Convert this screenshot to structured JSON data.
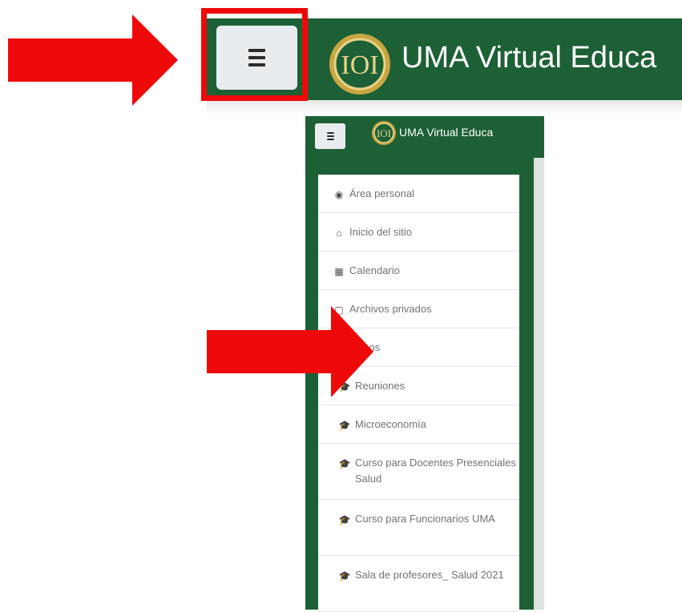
{
  "brand": {
    "name": "UMA Virtual Educa",
    "logo_text": "IOI",
    "header_color": "#1d6036",
    "annotation_color": "#ee0a0a"
  },
  "toggle_icon": "hamburger-icon",
  "nav": {
    "items": [
      {
        "label": "Área personal",
        "icon": "dashboard-icon",
        "glyph": "◉"
      },
      {
        "label": "Inicio del sitio",
        "icon": "home-icon",
        "glyph": "⌂"
      },
      {
        "label": "Calendario",
        "icon": "calendar-icon",
        "glyph": "▦"
      },
      {
        "label": "Archivos privados",
        "icon": "file-icon",
        "glyph": "▢"
      },
      {
        "label": "cursos",
        "icon": "graduation-cap-icon",
        "glyph": "🎓"
      }
    ],
    "courses": [
      {
        "label": "Reuniones",
        "icon": "graduation-cap-icon",
        "glyph": "🎓"
      },
      {
        "label": "Microeconomía",
        "icon": "graduation-cap-icon",
        "glyph": "🎓"
      },
      {
        "label": "Curso para Docentes Presenciales Salud",
        "icon": "graduation-cap-icon",
        "glyph": "🎓"
      },
      {
        "label": "Curso para Funcionarios UMA",
        "icon": "graduation-cap-icon",
        "glyph": "🎓"
      },
      {
        "label": "Sala de profesores_ Salud 2021",
        "icon": "graduation-cap-icon",
        "glyph": "🎓"
      }
    ]
  }
}
